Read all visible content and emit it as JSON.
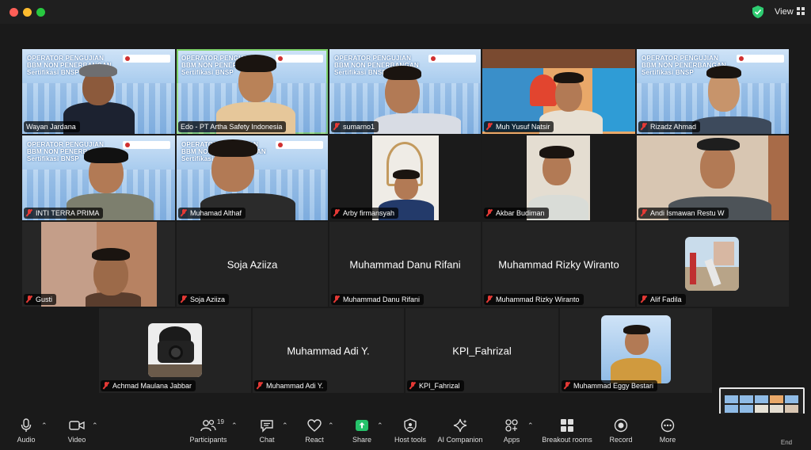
{
  "window": {
    "view_label": "View"
  },
  "banner_text": {
    "line1": "OPERATOR PENGUJIAN",
    "line2": "BBM NON PENERBANGAN",
    "line3": "Sertifikasi BNSP"
  },
  "participants": [
    {
      "name": "Wayan Jardana"
    },
    {
      "name": "Edo - PT Artha Safety Indonesia"
    },
    {
      "name": "sumarno1"
    },
    {
      "name": "Muh Yusuf Natsir"
    },
    {
      "name": "Rizadz Ahmad"
    },
    {
      "name": "INTI TERRA PRIMA"
    },
    {
      "name": "Muhamad Althaf"
    },
    {
      "name": "Arby firmansyah"
    },
    {
      "name": "Akbar Budiman"
    },
    {
      "name": "Andi Ismawan Restu W"
    },
    {
      "name": "Gusti"
    },
    {
      "name": "Soja Aziiza",
      "display": "Soja Aziiza"
    },
    {
      "name": "Muhammad Danu Rifani",
      "display": "Muhammad Danu Rifani"
    },
    {
      "name": "Muhammad Rizky Wiranto",
      "display": "Muhammad Rizky Wiranto"
    },
    {
      "name": "Alif Fadila"
    },
    {
      "name": "Achmad Maulana Jabbar"
    },
    {
      "name": "Muhammad Adi Y.",
      "display": "Muhammad Adi Y."
    },
    {
      "name": "KPI_Fahrizal",
      "display": "KPI_Fahrizal"
    },
    {
      "name": "Muhammad Eggy Bestari"
    }
  ],
  "toolbar": {
    "audio": "Audio",
    "video": "Video",
    "participants": "Participants",
    "participants_count": "19",
    "chat": "Chat",
    "react": "React",
    "share": "Share",
    "host_tools": "Host tools",
    "ai_companion": "AI Companion",
    "apps": "Apps",
    "breakout_rooms": "Breakout rooms",
    "record": "Record",
    "more": "More",
    "end": "End"
  },
  "colors": {
    "share_green": "#25c26a",
    "selected_outline": "#7ed36a",
    "muted_red": "#e53935"
  }
}
